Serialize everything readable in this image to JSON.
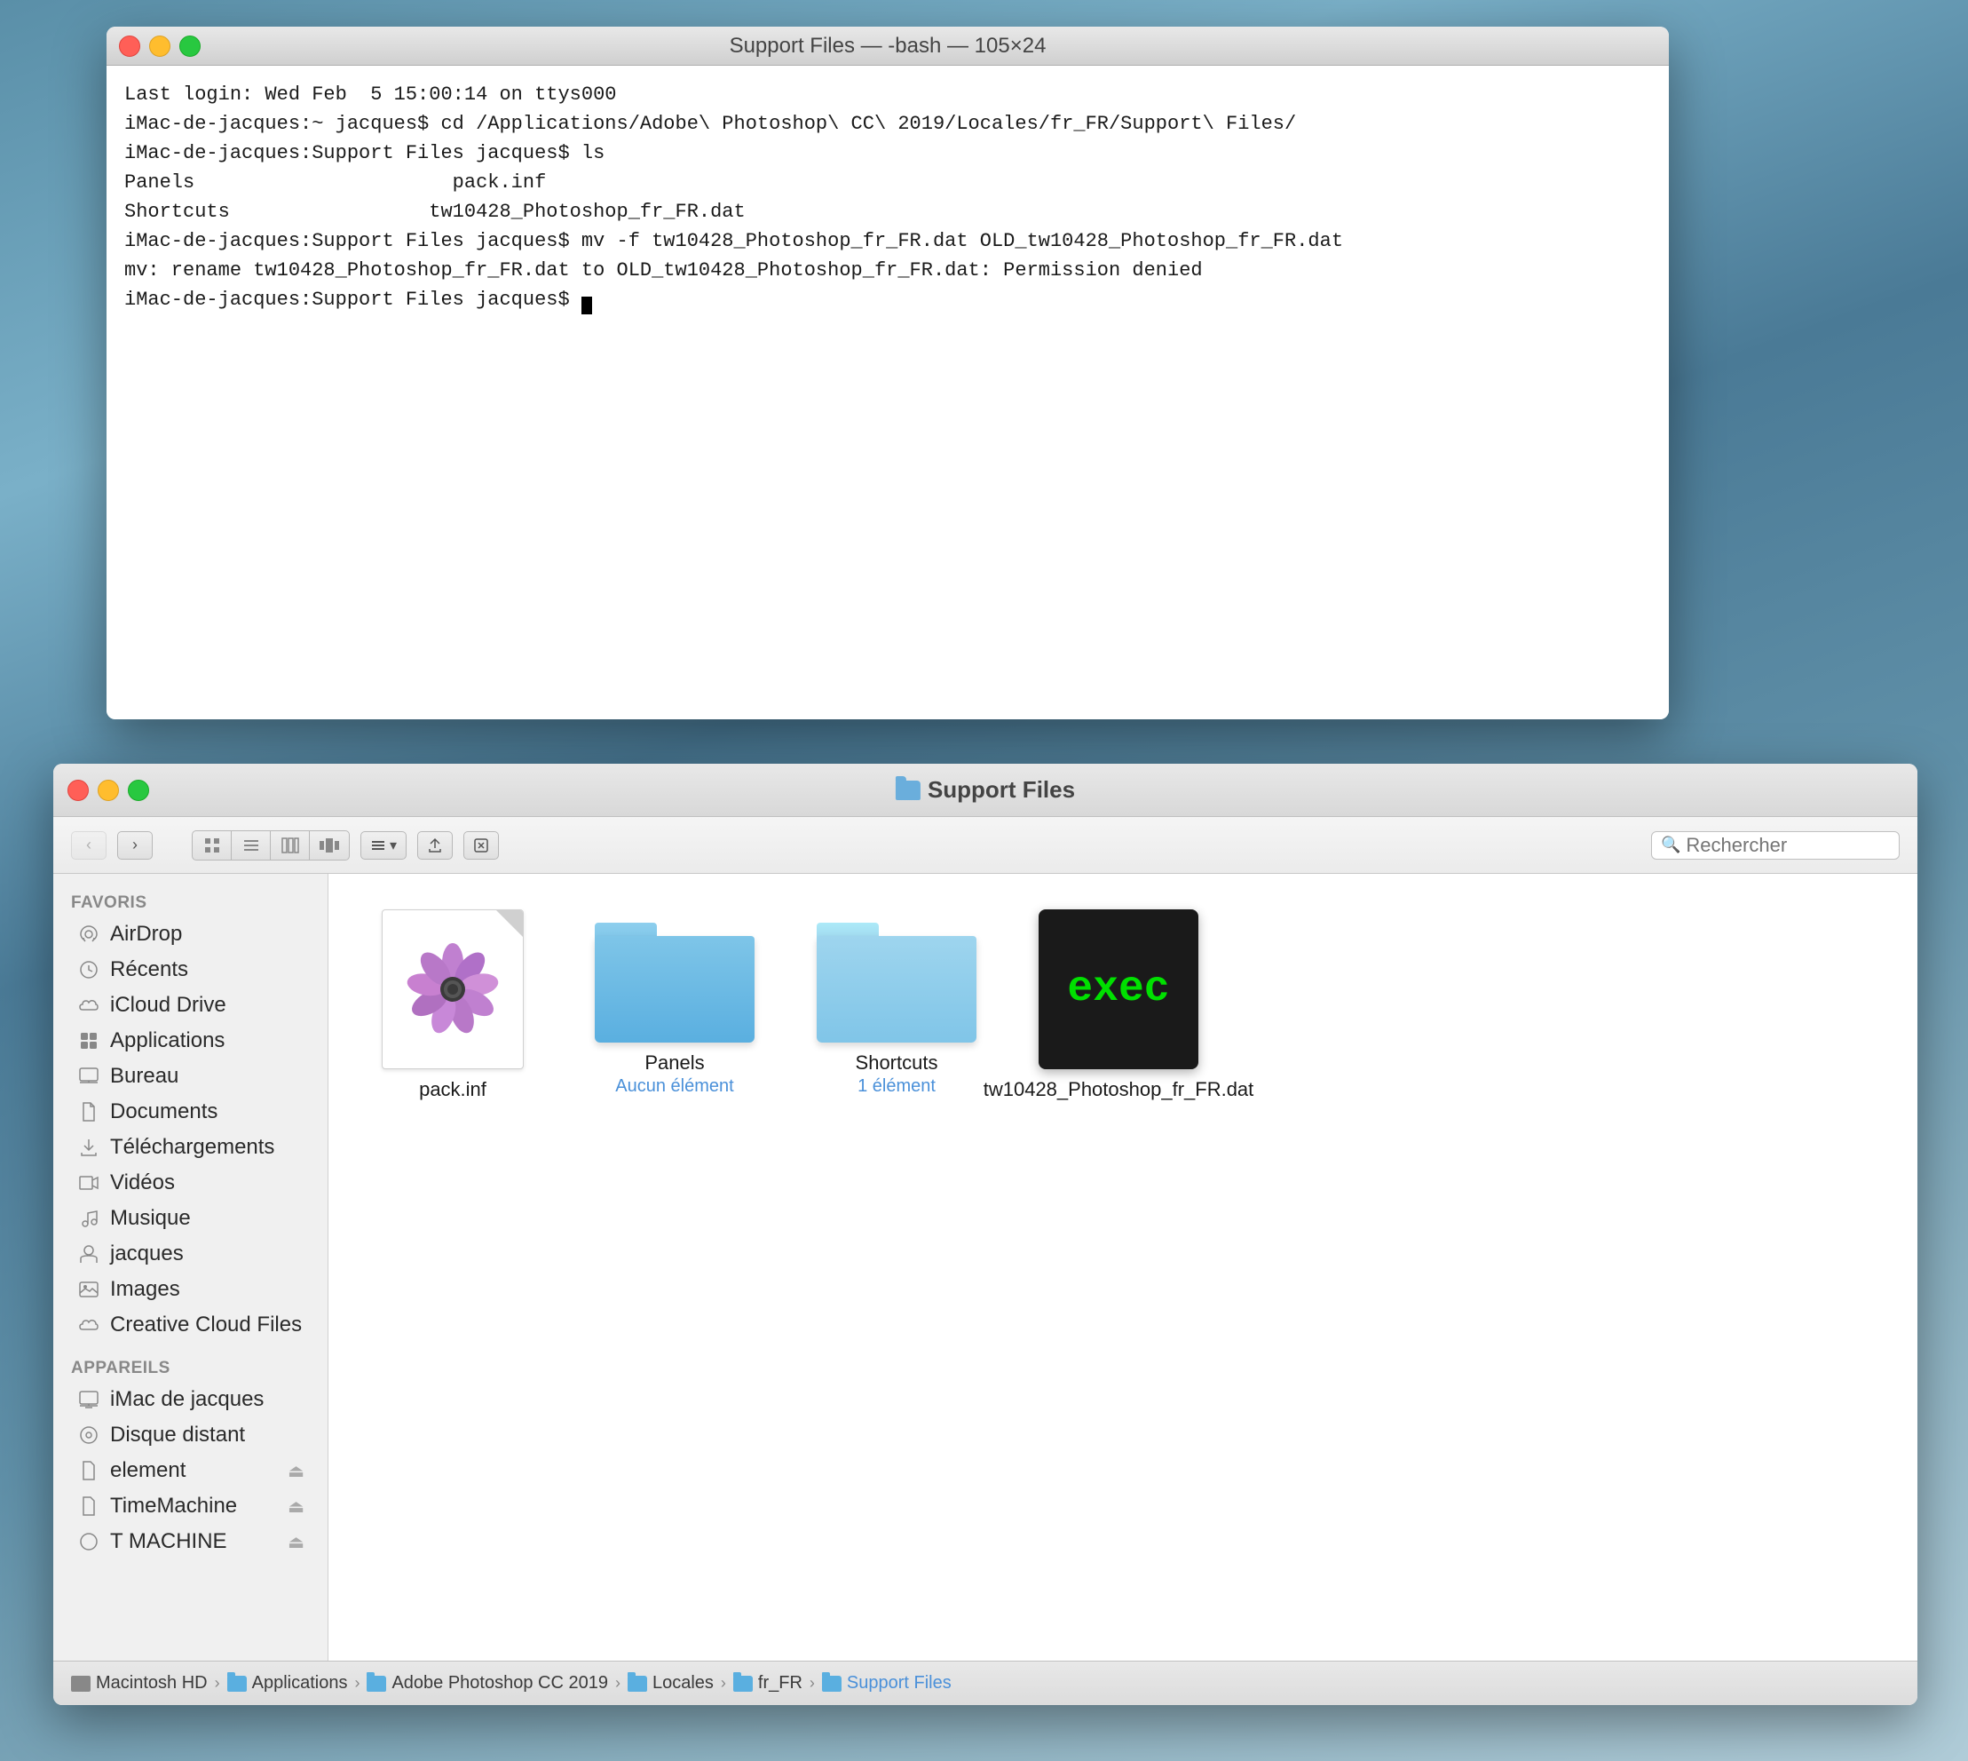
{
  "terminal": {
    "title": "Support Files — -bash — 105×24",
    "lines": [
      "Last login: Wed Feb  5 15:00:14 on ttys000",
      "iMac-de-jacques:~ jacques$ cd /Applications/Adobe\\ Photoshop\\ CC\\ 2019/Locales/fr_FR/Support\\ Files/",
      "iMac-de-jacques:Support Files jacques$ ls",
      "Panels                    pack.inf",
      "Shortcuts                 tw10428_Photoshop_fr_FR.dat",
      "iMac-de-jacques:Support Files jacques$ mv -f tw10428_Photoshop_fr_FR.dat OLD_tw10428_Photoshop_fr_FR.dat",
      "mv: rename tw10428_Photoshop_fr_FR.dat to OLD_tw10428_Photoshop_fr_FR.dat: Permission denied",
      "iMac-de-jacques:Support Files jacques$ "
    ]
  },
  "finder": {
    "title": "Support Files",
    "toolbar": {
      "back_btn": "‹",
      "forward_btn": "›",
      "search_placeholder": "Rechercher"
    },
    "sidebar": {
      "favoris_label": "Favoris",
      "appareils_label": "Appareils",
      "items_favoris": [
        {
          "id": "airdrop",
          "label": "AirDrop",
          "icon": "airdrop"
        },
        {
          "id": "recents",
          "label": "Récents",
          "icon": "clock"
        },
        {
          "id": "icloud",
          "label": "iCloud Drive",
          "icon": "icloud"
        },
        {
          "id": "applications",
          "label": "Applications",
          "icon": "grid"
        },
        {
          "id": "bureau",
          "label": "Bureau",
          "icon": "desktop"
        },
        {
          "id": "documents",
          "label": "Documents",
          "icon": "doc"
        },
        {
          "id": "telechargements",
          "label": "Téléchargements",
          "icon": "download"
        },
        {
          "id": "videos",
          "label": "Vidéos",
          "icon": "film"
        },
        {
          "id": "musique",
          "label": "Musique",
          "icon": "music"
        },
        {
          "id": "jacques",
          "label": "jacques",
          "icon": "home"
        },
        {
          "id": "images",
          "label": "Images",
          "icon": "photo"
        },
        {
          "id": "creativecloud",
          "label": "Creative Cloud Files",
          "icon": "cloud"
        }
      ],
      "items_appareils": [
        {
          "id": "imac",
          "label": "iMac de jacques",
          "icon": "imac",
          "eject": false
        },
        {
          "id": "distantdisk",
          "label": "Disque distant",
          "icon": "disk",
          "eject": false
        },
        {
          "id": "element",
          "label": "element",
          "icon": "usb",
          "eject": true
        },
        {
          "id": "timemachine",
          "label": "TimeMachine",
          "icon": "usb",
          "eject": true
        },
        {
          "id": "tmachine",
          "label": "T MACHINE",
          "icon": "disk2",
          "eject": true
        }
      ]
    },
    "files": [
      {
        "id": "pack-inf",
        "name": "pack.inf",
        "type": "packInf",
        "subtitle": ""
      },
      {
        "id": "panels",
        "name": "Panels",
        "type": "folder",
        "subtitle": "Aucun élément"
      },
      {
        "id": "shortcuts",
        "name": "Shortcuts",
        "type": "folder-light",
        "subtitle": "1 élément"
      },
      {
        "id": "tw-dat",
        "name": "tw10428_Photoshop_fr_FR.dat",
        "type": "exec",
        "subtitle": ""
      }
    ],
    "breadcrumb": [
      {
        "id": "hd",
        "label": "Macintosh HD",
        "type": "hd"
      },
      {
        "id": "applications",
        "label": "Applications",
        "type": "folder"
      },
      {
        "id": "photoshop",
        "label": "Adobe Photoshop CC 2019",
        "type": "folder"
      },
      {
        "id": "locales",
        "label": "Locales",
        "type": "folder"
      },
      {
        "id": "frfr",
        "label": "fr_FR",
        "type": "folder"
      },
      {
        "id": "supportfiles",
        "label": "Support Files",
        "type": "folder"
      }
    ]
  }
}
